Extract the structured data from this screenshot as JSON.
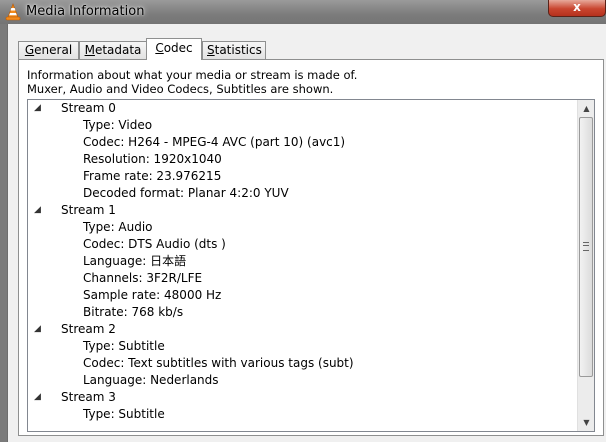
{
  "window": {
    "title": "Media Information",
    "close_label": "x",
    "icon": "vlc-cone-icon"
  },
  "tabs": [
    {
      "label": "General",
      "active": false
    },
    {
      "label": "Metadata",
      "active": false
    },
    {
      "label": "Codec",
      "active": true
    },
    {
      "label": "Statistics",
      "active": false
    }
  ],
  "description": {
    "line1": "Information about what your media or stream is made of.",
    "line2": "Muxer, Audio and Video Codecs, Subtitles are shown."
  },
  "streams": [
    {
      "label": "Stream 0",
      "props": [
        "Type: Video",
        "Codec: H264 - MPEG-4 AVC (part 10) (avc1)",
        "Resolution: 1920x1040",
        "Frame rate: 23.976215",
        "Decoded format: Planar 4:2:0 YUV"
      ]
    },
    {
      "label": "Stream 1",
      "props": [
        "Type: Audio",
        "Codec: DTS Audio (dts )",
        "Language: 日本語",
        "Channels: 3F2R/LFE",
        "Sample rate: 48000 Hz",
        "Bitrate: 768 kb/s"
      ]
    },
    {
      "label": "Stream 2",
      "props": [
        "Type: Subtitle",
        "Codec: Text subtitles with various tags (subt)",
        "Language: Nederlands"
      ]
    },
    {
      "label": "Stream 3",
      "props": [
        "Type: Subtitle"
      ]
    }
  ],
  "scrollbar": {
    "position_fraction": 0.0
  }
}
